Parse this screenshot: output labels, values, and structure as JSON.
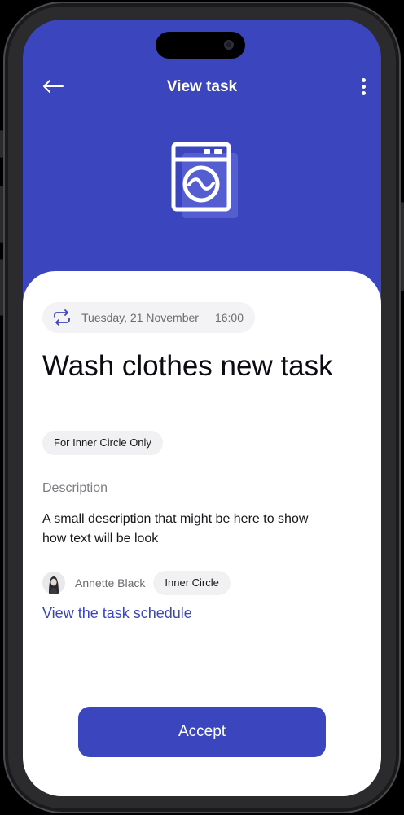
{
  "header": {
    "title": "View task",
    "back_icon": "arrow-left-icon",
    "menu_icon": "more-vertical-icon",
    "task_icon": "washing-machine-icon"
  },
  "task": {
    "repeat_icon": "repeat-icon",
    "date": "Tuesday, 21 November",
    "time": "16:00",
    "title": "Wash clothes new task",
    "visibility_tag": "For Inner Circle Only",
    "description_label": "Description",
    "description": "A small description that might be here to show how text will be look",
    "owner": {
      "name": "Annette Black",
      "group": "Inner Circle"
    },
    "schedule_link": "View the task schedule"
  },
  "actions": {
    "accept_label": "Accept"
  },
  "colors": {
    "accent": "#3b45bd",
    "background": "#ffffff",
    "pill": "#f3f3f5"
  }
}
